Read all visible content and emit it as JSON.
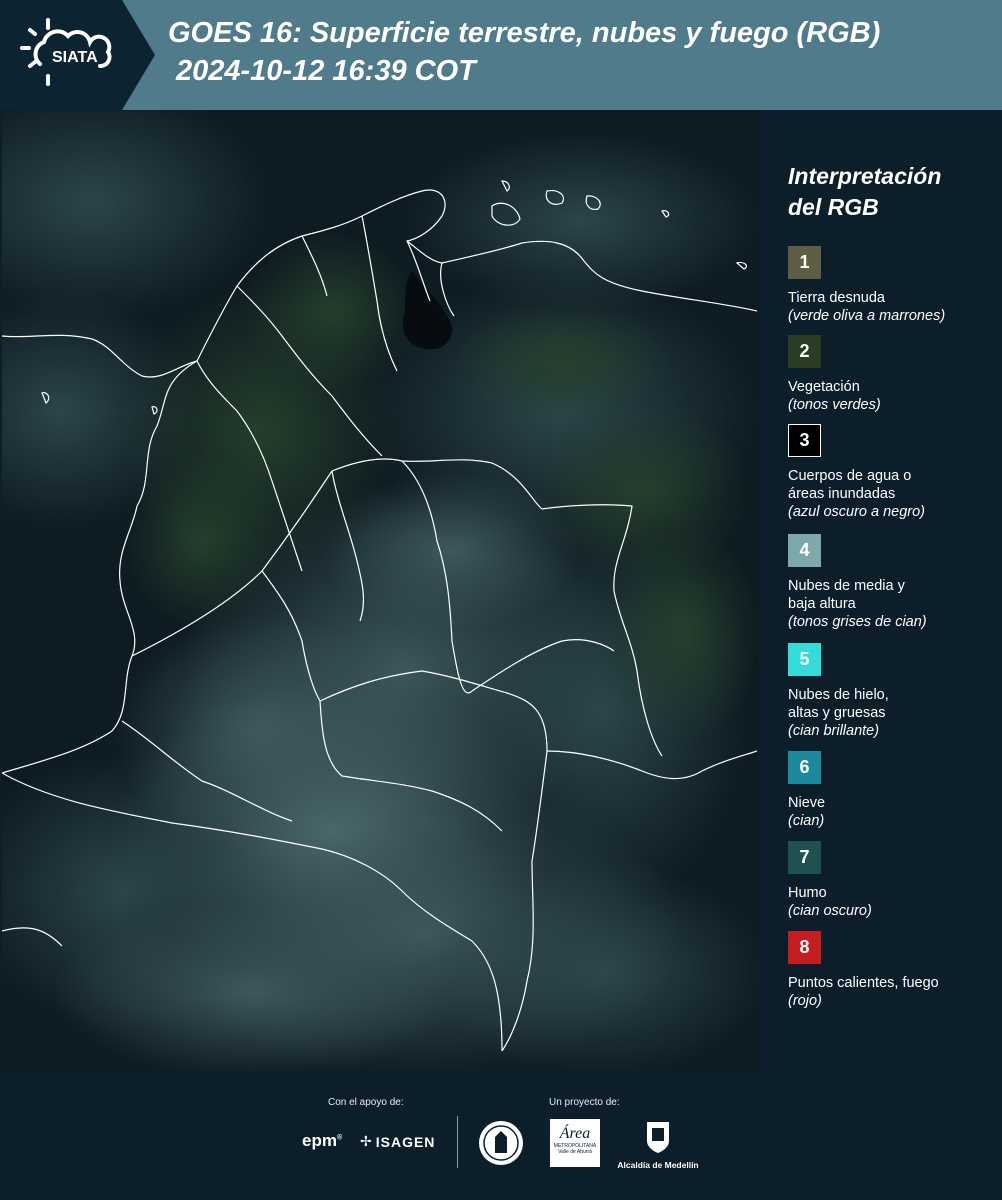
{
  "header": {
    "brand": "SIATA",
    "title_line1": "GOES 16: Superficie terrestre, nubes y fuego (RGB)",
    "title_line2": "2024-10-12 16:39 COT",
    "brand_icon": "sun-cloud-icon"
  },
  "legend": {
    "title_line1": "Interpretación",
    "title_line2": "del RGB",
    "items": [
      {
        "num": "1",
        "color": "#5d5e45",
        "label_lines": [
          "Tierra desnuda"
        ],
        "desc": "(verde oliva a marrones)"
      },
      {
        "num": "2",
        "color": "#283d22",
        "label_lines": [
          "Vegetación"
        ],
        "desc": "(tonos verdes)"
      },
      {
        "num": "3",
        "color": "#000000",
        "label_lines": [
          "Cuerpos de agua o",
          "áreas inundadas"
        ],
        "desc": "(azul oscuro a negro)"
      },
      {
        "num": "4",
        "color": "#7fa8a8",
        "label_lines": [
          "Nubes de media y",
          "baja altura"
        ],
        "desc": "(tonos grises de cian)"
      },
      {
        "num": "5",
        "color": "#34dcd9",
        "label_lines": [
          "Nubes de hielo,",
          "altas y gruesas"
        ],
        "desc": "(cian brillante)"
      },
      {
        "num": "6",
        "color": "#1c8a9c",
        "label_lines": [
          "Nieve"
        ],
        "desc": "(cian)"
      },
      {
        "num": "7",
        "color": "#1f5151",
        "label_lines": [
          "Humo"
        ],
        "desc": "(cian oscuro)"
      },
      {
        "num": "8",
        "color": "#c41e22",
        "label_lines": [
          "Puntos calientes, fuego"
        ],
        "desc": "(rojo)"
      }
    ]
  },
  "footer": {
    "support_caption": "Con el apoyo de:",
    "project_caption": "Un proyecto de:",
    "logos": {
      "epm": "epm",
      "isagen": "ISAGEN",
      "area": "Área",
      "area_sub1": "METROPOLITANA",
      "area_sub2": "Valle de Aburrá",
      "alcaldia": "Alcaldía de Medellín"
    }
  }
}
